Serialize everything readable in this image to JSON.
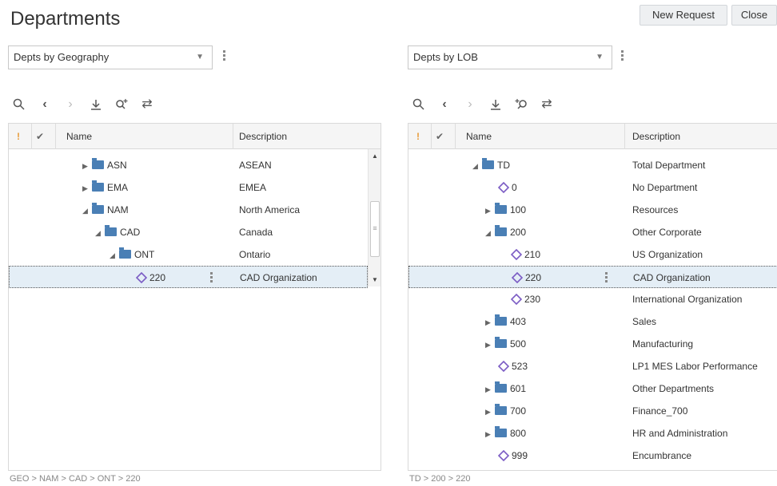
{
  "page": {
    "title": "Departments"
  },
  "buttons": {
    "new_request": "New Request",
    "close": "Close"
  },
  "left": {
    "hierarchy_select": "Depts by Geography",
    "columns": {
      "alert": "!",
      "check": "✔",
      "name": "Name",
      "description": "Description"
    },
    "rows": [
      {
        "name": "ASN",
        "description": "ASEAN",
        "type": "folder",
        "expanded": false,
        "level": 3
      },
      {
        "name": "EMA",
        "description": "EMEA",
        "type": "folder",
        "expanded": false,
        "level": 3
      },
      {
        "name": "NAM",
        "description": "North America",
        "type": "folder",
        "expanded": true,
        "level": 3
      },
      {
        "name": "CAD",
        "description": "Canada",
        "type": "folder",
        "expanded": true,
        "level": 4
      },
      {
        "name": "ONT",
        "description": "Ontario",
        "type": "folder",
        "expanded": true,
        "level": 5
      },
      {
        "name": "220",
        "description": "CAD Organization",
        "type": "member",
        "level": 6,
        "selected": true
      }
    ],
    "breadcrumb": "GEO > NAM > CAD > ONT > 220"
  },
  "right": {
    "hierarchy_select": "Depts by LOB",
    "columns": {
      "alert": "!",
      "check": "✔",
      "name": "Name",
      "description": "Description"
    },
    "rows": [
      {
        "name": "TD",
        "description": "Total Department",
        "type": "folder",
        "expanded": true,
        "level": 1
      },
      {
        "name": "0",
        "description": "No Department",
        "type": "member",
        "level": 2
      },
      {
        "name": "100",
        "description": "Resources",
        "type": "folder",
        "expanded": false,
        "level": 2
      },
      {
        "name": "200",
        "description": "Other Corporate",
        "type": "folder",
        "expanded": true,
        "level": 2
      },
      {
        "name": "210",
        "description": "US Organization",
        "type": "member",
        "level": 3
      },
      {
        "name": "220",
        "description": "CAD Organization",
        "type": "member",
        "level": 3,
        "selected": true
      },
      {
        "name": "230",
        "description": "International Organization",
        "type": "member",
        "level": 3
      },
      {
        "name": "403",
        "description": "Sales",
        "type": "folder",
        "expanded": false,
        "level": 2
      },
      {
        "name": "500",
        "description": "Manufacturing",
        "type": "folder",
        "expanded": false,
        "level": 2
      },
      {
        "name": "523",
        "description": "LP1 MES Labor Performance",
        "type": "member",
        "level": 2
      },
      {
        "name": "601",
        "description": "Other Departments",
        "type": "folder",
        "expanded": false,
        "level": 2
      },
      {
        "name": "700",
        "description": "Finance_700",
        "type": "folder",
        "expanded": false,
        "level": 2
      },
      {
        "name": "800",
        "description": "HR and Administration",
        "type": "folder",
        "expanded": false,
        "level": 2
      },
      {
        "name": "999",
        "description": "Encumbrance",
        "type": "member",
        "level": 2
      }
    ],
    "breadcrumb": "TD > 200 > 220"
  },
  "toolbar_icons": [
    "search-icon",
    "back-icon",
    "forward-icon",
    "download-icon",
    "search-in-hierarchy-icon",
    "swap-icon"
  ],
  "colors": {
    "folder": "#4a7fb5",
    "member": "#7b5cc4",
    "selected_row": "#e4eef6",
    "alert": "#e89c3a"
  }
}
